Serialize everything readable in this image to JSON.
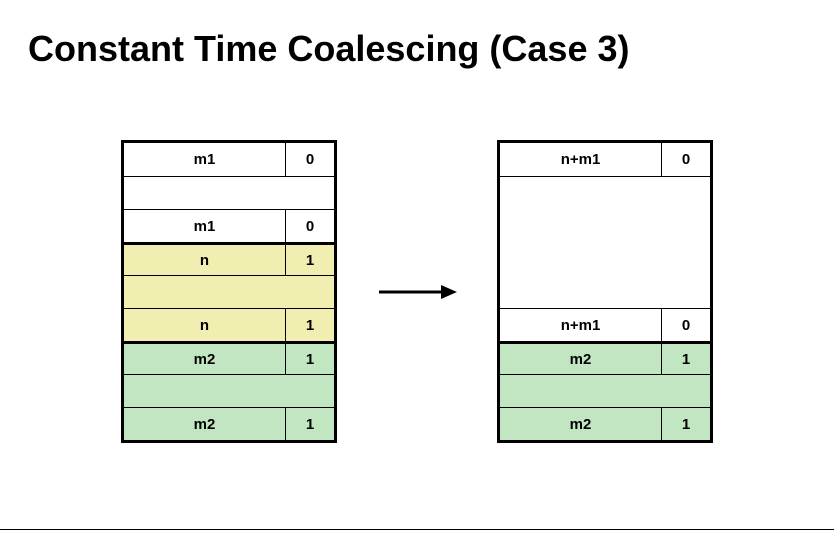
{
  "title": "Constant Time Coalescing (Case 3)",
  "left": {
    "block1": {
      "header_size": "m1",
      "header_bit": "0",
      "footer_size": "m1",
      "footer_bit": "0",
      "color": "white"
    },
    "block2": {
      "header_size": "n",
      "header_bit": "1",
      "footer_size": "n",
      "footer_bit": "1",
      "color": "yellow"
    },
    "block3": {
      "header_size": "m2",
      "header_bit": "1",
      "footer_size": "m2",
      "footer_bit": "1",
      "color": "green"
    }
  },
  "right": {
    "block1": {
      "header_size": "n+m1",
      "header_bit": "0",
      "footer_size": "n+m1",
      "footer_bit": "0",
      "color": "white"
    },
    "block3": {
      "header_size": "m2",
      "header_bit": "1",
      "footer_size": "m2",
      "footer_bit": "1",
      "color": "green"
    }
  }
}
